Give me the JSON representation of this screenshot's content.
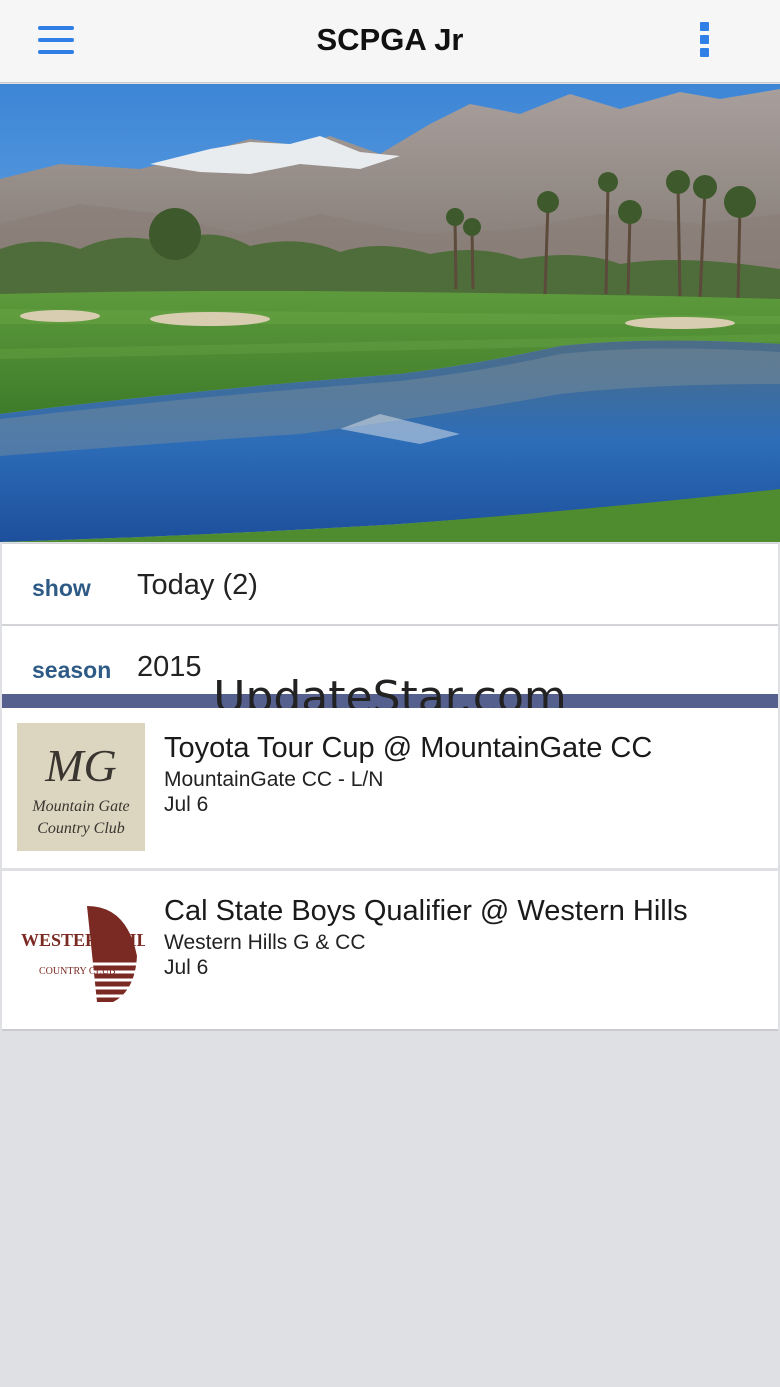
{
  "app": {
    "title": "SCPGA Jr"
  },
  "header": {
    "menu_icon": "hamburger-menu-icon",
    "more_icon": "vertical-dots-icon"
  },
  "filters": {
    "show": {
      "label": "show",
      "value": "Today (2)"
    },
    "season": {
      "label": "season",
      "value": "2015"
    }
  },
  "watermark": "UpdateStar.com",
  "events": [
    {
      "title": "Toyota Tour Cup @ MountainGate CC",
      "venue": "MountainGate CC - L/N",
      "date": "Jul 6",
      "logo_text": [
        "MG",
        "Mountain Gate",
        "Country Club"
      ]
    },
    {
      "title": "Cal State Boys Qualifier @ Western Hills",
      "venue": "Western Hills G & CC",
      "date": "Jul 6",
      "logo_text": [
        "WESTERN HILLS",
        "COUNTRY CLUB"
      ]
    }
  ],
  "colors": {
    "accent": "#2f7fe6",
    "label": "#2e5b86",
    "band": "#56608f"
  }
}
